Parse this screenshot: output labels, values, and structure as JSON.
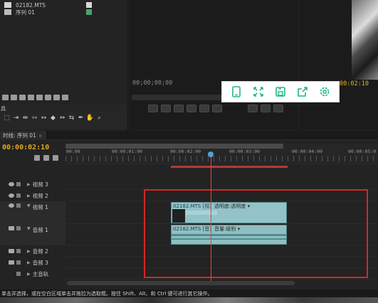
{
  "project": {
    "items": [
      {
        "name": "02182.MTS",
        "icon": "video-clip-icon",
        "swatch": "#d9d9d9"
      },
      {
        "name": "序列 01",
        "icon": "sequence-icon",
        "swatch": "#4aa06f"
      }
    ]
  },
  "source_monitor": {
    "timecode": "00;00;00;00"
  },
  "program_monitor": {
    "timecode": "00:02:10"
  },
  "share_toolbar": {
    "buttons": [
      "phone-icon",
      "fullscreen-icon",
      "save-icon",
      "share-icon",
      "settings-icon"
    ],
    "accent": "#1fb58a"
  },
  "tools": {
    "label": "具",
    "items": [
      "selection",
      "track-select",
      "ripple-edit",
      "rolling-edit",
      "rate-stretch",
      "razor",
      "slip",
      "slide",
      "pen",
      "hand",
      "zoom"
    ]
  },
  "timeline": {
    "tab_label": "时线: 序列 01",
    "timecode": "00:00:02:10",
    "ruler": [
      "00:00",
      "00:00:01:00",
      "00:00:02:00",
      "00:00:03:00",
      "00:00:04:00",
      "00:00:05:0"
    ],
    "tracks": {
      "video3": "视频 3",
      "video2": "视频 2",
      "video1": "视频 1",
      "audio1": "音频 1",
      "audio2": "音频 2",
      "audio3": "音频 3",
      "master": "主音轨"
    },
    "video_clip": {
      "title": "02182.MTS",
      "tag": "[视]",
      "effect": "透明度:透明度"
    },
    "audio_clip": {
      "title": "02182.MTS",
      "tag": "[音]",
      "effect": "音量:级别"
    }
  },
  "status_bar": {
    "text": "单击并选择，或在空白区域单击并拖拉为选取框。按住 Shift、Alt、和 Ctrl 键可进行其它操作。"
  }
}
